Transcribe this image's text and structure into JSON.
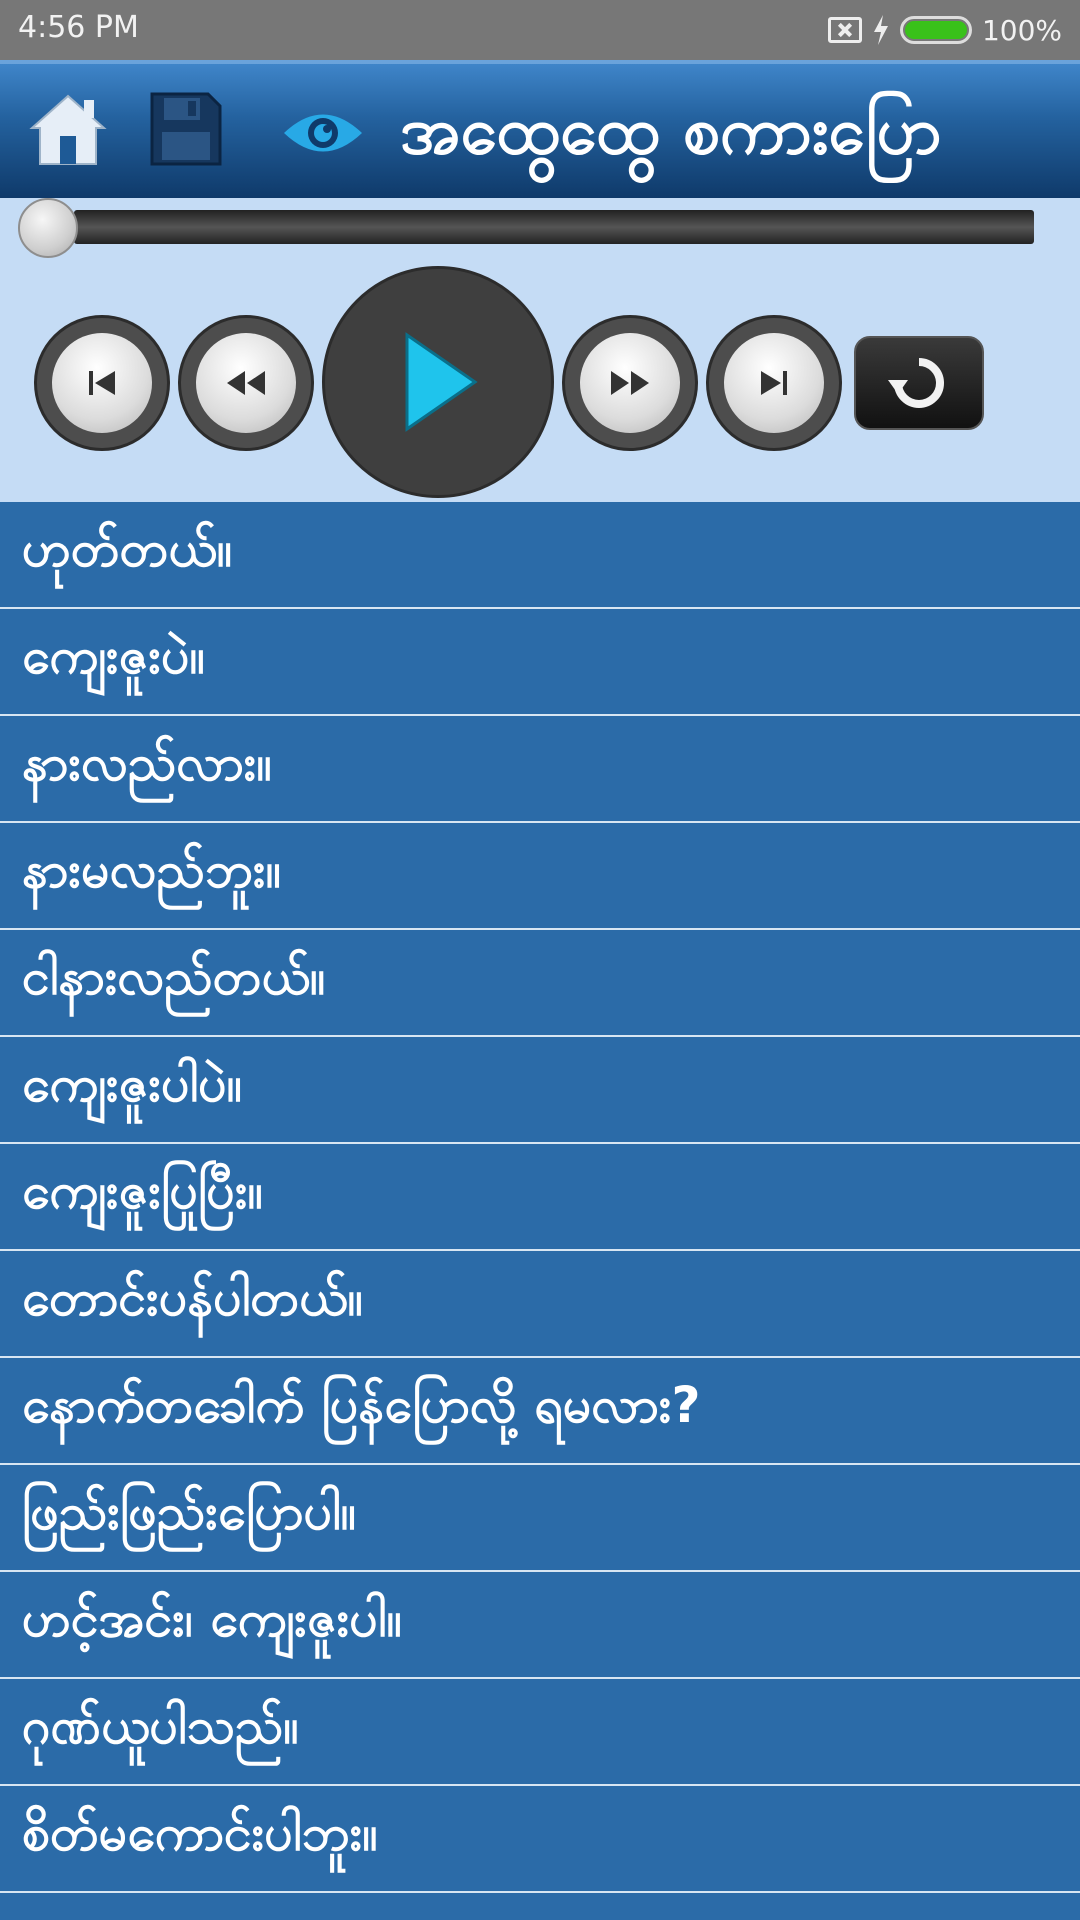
{
  "status_bar": {
    "time": "4:56 PM",
    "battery_percent": "100%",
    "battery_level": 1.0
  },
  "header": {
    "title": "အထွေထွေ စကားပြော",
    "icons": [
      "home-icon",
      "save-icon",
      "eye-icon"
    ]
  },
  "player": {
    "progress": 0.0,
    "controls": [
      "skip-previous-icon",
      "rewind-icon",
      "play-icon",
      "fast-forward-icon",
      "skip-next-icon",
      "repeat-icon"
    ],
    "accent_color": "#1fc4ec"
  },
  "phrases": [
    "ဟုတ်တယ်။",
    "ကျေးဇူးပဲ။",
    "နားလည်လား။",
    "နားမလည်ဘူး။",
    "ငါနားလည်တယ်။",
    "ကျေးဇူးပါပဲ။",
    "ကျေးဇူးပြုပြီး။",
    "တောင်းပန်ပါတယ်။",
    "နောက်တခေါက် ပြန်ပြောလို့ ရမလား?",
    "ဖြည်းဖြည်းပြောပါ။",
    "ဟင့်အင်း၊ ကျေးဇူးပါ။",
    "ဂုဏ်ယူပါသည်။",
    "စိတ်မကောင်းပါဘူး။"
  ],
  "colors": {
    "list_bg": "#2b6ba8",
    "player_bg": "#c5dcf5",
    "header_dark": "#0f3a6a"
  }
}
